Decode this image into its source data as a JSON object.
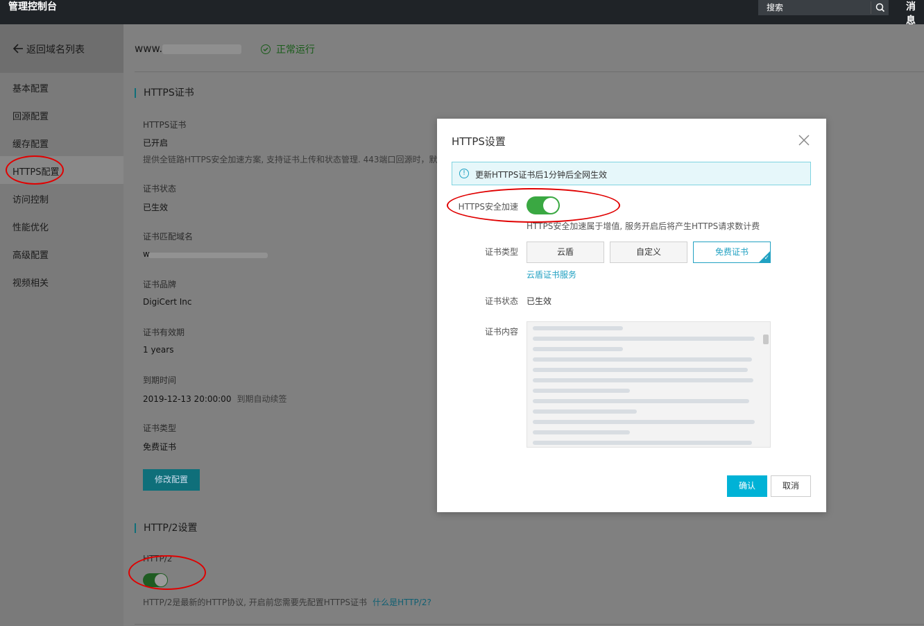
{
  "topbar": {
    "title": "管理控制台",
    "search_placeholder": "搜索",
    "message_label": "消息"
  },
  "sidebar": {
    "back_label": "返回域名列表",
    "items": [
      {
        "label": "基本配置"
      },
      {
        "label": "回源配置"
      },
      {
        "label": "缓存配置"
      },
      {
        "label": "HTTPS配置",
        "active": true
      },
      {
        "label": "访问控制"
      },
      {
        "label": "性能优化"
      },
      {
        "label": "高级配置"
      },
      {
        "label": "视频相关"
      }
    ]
  },
  "header": {
    "domain_prefix": "www.",
    "status": "正常运行"
  },
  "https_section": {
    "title": "HTTPS证书",
    "cert_label": "HTTPS证书",
    "cert_value": "已开启",
    "cert_desc": "提供全链路HTTPS安全加速方案, 支持证书上传和状态管理. 443端口回源时，默认",
    "status_label": "证书状态",
    "status_value": "已生效",
    "match_label": "证书匹配域名",
    "match_value_prefix": "w",
    "brand_label": "证书品牌",
    "brand_value": "DigiCert Inc",
    "validity_label": "证书有效期",
    "validity_value": "1 years",
    "expire_label": "到期时间",
    "expire_value": "2019-12-13 20:00:00",
    "expire_note": "到期自动续签",
    "type_label": "证书类型",
    "type_value": "免费证书",
    "edit_button": "修改配置"
  },
  "http2_section": {
    "title": "HTTP/2设置",
    "label": "HTTP/2",
    "enabled": true,
    "desc": "HTTP/2是最新的HTTP协议, 开启前您需要先配置HTTPS证书",
    "link": "什么是HTTP/2?"
  },
  "modal": {
    "title": "HTTPS设置",
    "notice": "更新HTTPS证书后1分钟后全网生效",
    "accel_label": "HTTPS安全加速",
    "accel_enabled": true,
    "accel_desc": "HTTPS安全加速属于增值, 服务开启后将产生HTTPS请求数计费",
    "cert_type_label": "证书类型",
    "cert_types": [
      "云盾",
      "自定义",
      "免费证书"
    ],
    "cert_type_selected": "免费证书",
    "cert_service_link": "云盾证书服务",
    "cert_status_label": "证书状态",
    "cert_status_value": "已生效",
    "cert_content_label": "证书内容",
    "confirm_button": "确认",
    "cancel_button": "取消"
  },
  "colors": {
    "topbar_bg": "#1f2327",
    "accent": "#00b2d6",
    "toggle_on": "#3aa842",
    "annotation_red": "#e00000"
  }
}
